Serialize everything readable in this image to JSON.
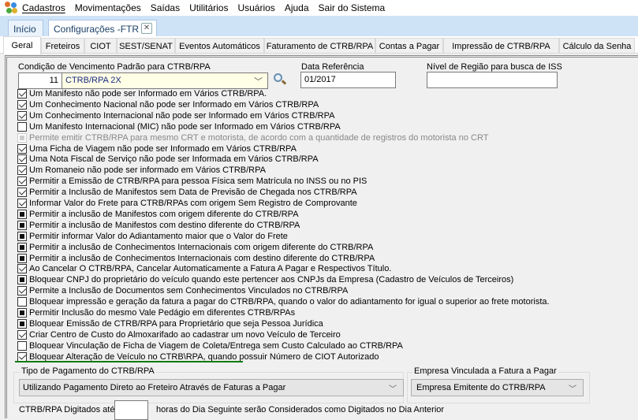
{
  "menu": {
    "items": [
      "Cadastros",
      "Movimentações",
      "Saídas",
      "Utilitários",
      "Usuários",
      "Ajuda",
      "Sair do Sistema"
    ],
    "underline": [
      "C",
      "M",
      "S",
      "U",
      "r",
      "A",
      ""
    ]
  },
  "doc_tabs": [
    {
      "label": "Início",
      "active": false
    },
    {
      "label": "Configurações -FTR",
      "active": true,
      "closable": true
    }
  ],
  "sub_tabs": [
    "Geral",
    "Freteiros",
    "CIOT",
    "SEST/SENAT",
    "Eventos Automáticos",
    "Faturamento de CTRB/RPA",
    "Contas a Pagar",
    "Impressão de CTRB/RPA",
    "Cálculo da Senha"
  ],
  "active_sub_tab": "Geral",
  "form": {
    "condicao_label": "Condição de Vencimento Padrão para CTRB/RPA",
    "condicao_code": "11",
    "condicao_value": "CTRB/RPA 2X",
    "data_ref_label": "Data Referência",
    "data_ref_value": "01/2017",
    "nivel_label": "Nível de Região para busca de ISS",
    "nivel_value": ""
  },
  "options": [
    {
      "label": "Um Manifesto não pode ser Informado em Vários CTRB/RPA.",
      "state": "checked"
    },
    {
      "label": "Um Conhecimento Nacional não pode ser Informado em Vários CTRB/RPA",
      "state": "checked"
    },
    {
      "label": "Um Conhecimento Internacional não pode ser Informado em Vários CTRB/RPA",
      "state": "checked"
    },
    {
      "label": "Um Manifesto Internacional (MIC)  não pode ser Informado em Vários CTRB/RPA",
      "state": "unchecked"
    },
    {
      "label": "Permite emitir CTRB/RPA para mesmo CRT e motorista, de acordo com a quantidade de registros do motorista no CRT",
      "state": "disabled"
    },
    {
      "label": "Uma Ficha de Viagem não pode ser Informado em Vários CTRB/RPA",
      "state": "checked"
    },
    {
      "label": "Uma Nota Fiscal de Serviço não pode ser Informada em Vários CTRB/RPA",
      "state": "checked"
    },
    {
      "label": "Um Romaneio não pode ser informado em Vários CTRB/RPA",
      "state": "checked"
    },
    {
      "label": "Permitir a Emissão de CTRB/RPA para pessoa Física sem Matrícula no INSS ou no PIS",
      "state": "checked"
    },
    {
      "label": "Permitir a Inclusão de Manifestos sem Data de Previsão de Chegada nos CTRB/RPA",
      "state": "checked"
    },
    {
      "label": "Informar Valor do Frete para CTRB/RPAs com origem Sem Registro de Comprovante",
      "state": "checked"
    },
    {
      "label": "Permitir a inclusão de Manifestos com origem diferente do CTRB/RPA",
      "state": "indeterminate"
    },
    {
      "label": "Permitir a inclusão de Manifestos com destino diferente do CTRB/RPA",
      "state": "indeterminate"
    },
    {
      "label": "Permitir informar Valor do Adiantamento maior que o Valor do Frete",
      "state": "indeterminate"
    },
    {
      "label": "Permitir a inclusão de Conhecimentos Internacionais com origem diferente do CTRB/RPA",
      "state": "indeterminate"
    },
    {
      "label": "Permitir a inclusão de Conhecimentos Internacionais com destino diferente do CTRB/RPA",
      "state": "indeterminate"
    },
    {
      "label": "Ao Cancelar O CTRB/RPA, Cancelar Automaticamente a Fatura A Pagar e Respectivos Título.",
      "state": "checked"
    },
    {
      "label": "Bloquear CNPJ do proprietário do veículo quando este pertencer aos CNPJs da Empresa (Cadastro de Veículos de Terceiros)",
      "state": "indeterminate"
    },
    {
      "label": "Permite a Inclusão de Documentos sem Conhecimentos Vinculados no CTRB/RPA",
      "state": "checked"
    },
    {
      "label": "Bloquear impressão e geração da fatura  a pagar do CTRB/RPA, quando o valor do adiantamento for igual o superior ao frete motorista.",
      "state": "unchecked"
    },
    {
      "label": "Permitir Inclusão do mesmo Vale Pedágio em diferentes CTRB/RPAs",
      "state": "indeterminate"
    },
    {
      "label": "Bloquear Emissão de CTRB/RPA para Proprietário que seja Pessoa Jurídica",
      "state": "indeterminate"
    },
    {
      "label": "Criar Centro de Custo do Almoxarifado ao cadastrar um novo Veículo de Terceiro",
      "state": "checked"
    },
    {
      "label": "Bloquear Vinculação de Ficha de Viagem de Coleta/Entrega sem Custo Calculado ao CTRB/RPA",
      "state": "unchecked"
    },
    {
      "label": "Bloquear Alteração de Veículo no CTRB\\RPA, quando possuir Número de CIOT Autorizado",
      "state": "checked"
    }
  ],
  "highlight_color": "#0a7a0a",
  "pagamento": {
    "label": "Tipo de Pagamento do CTRB/RPA",
    "value": "Utilizando Pagamento Direto ao Freteiro Através de Faturas a Pagar"
  },
  "empresa": {
    "label": "Empresa Vinculada a Fatura a Pagar",
    "value": "Empresa Emitente do CTRB/RPA"
  },
  "digitados": {
    "prefix": "CTRB/RPA Digitados até",
    "value": "",
    "suffix": "horas do Dia Seguinte serão Considerados como Digitados no Dia Anterior"
  }
}
